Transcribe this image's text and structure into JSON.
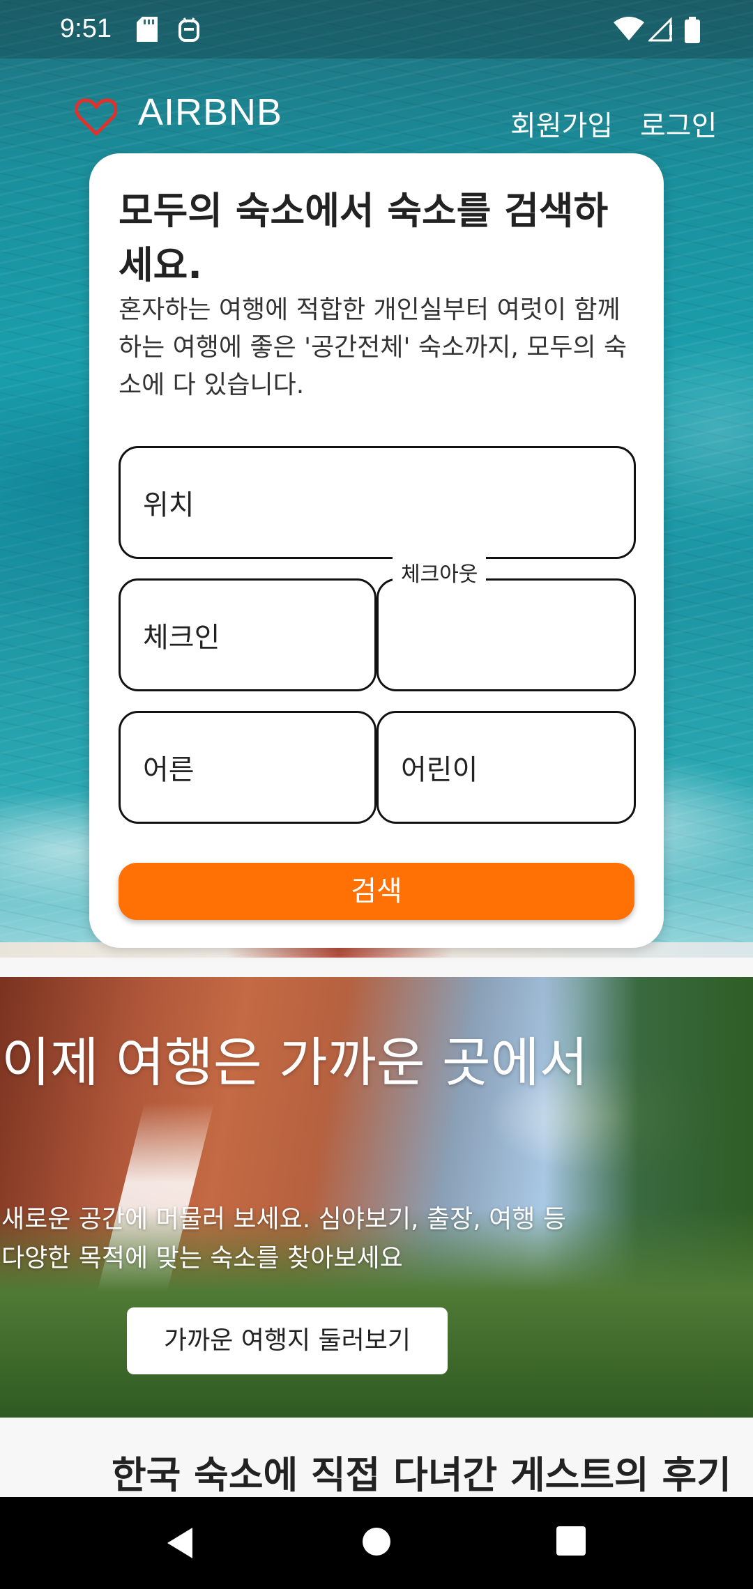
{
  "status_bar": {
    "time": "9:51",
    "icons": [
      "sd-card-icon",
      "bot-icon",
      "wifi-icon",
      "cell-signal-icon",
      "battery-icon"
    ]
  },
  "header": {
    "brand": "AIRBNB",
    "brand_icon": "heart-icon",
    "signup_label": "회원가입",
    "login_label": "로그인"
  },
  "search_card": {
    "title": "모두의 숙소에서 숙소를 검색하세요.",
    "description": "혼자하는 여행에 적합한 개인실부터 여럿이 함께하는 여행에 좋은 '공간전체' 숙소까지, 모두의 숙소에 다 있습니다.",
    "location_label": "위치",
    "checkin_label": "체크인",
    "checkout_label": "체크아웃",
    "adults_label": "어른",
    "children_label": "어린이",
    "search_button": "검색"
  },
  "promo": {
    "title": "이제 여행은 가까운 곳에서",
    "description": "새로운 공간에 머물러 보세요. 심야보기, 출장, 여행 등 다양한 목적에 맞는 숙소를 찾아보세요",
    "button": "가까운 여행지 둘러보기"
  },
  "reviews": {
    "title": "한국 숙소에 직접 다녀간 게스트의 후기"
  },
  "nav_bar": {
    "icons": [
      "back-icon",
      "home-icon",
      "recents-icon"
    ]
  },
  "colors": {
    "accent": "#ff7105",
    "heart": "#e0322c"
  }
}
